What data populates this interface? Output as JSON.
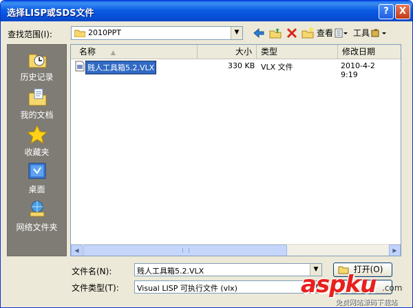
{
  "window": {
    "title": "选择LISP或SDS文件",
    "help_label": "?",
    "close_label": "X"
  },
  "lookin": {
    "label": "查找范围(I):",
    "value": "2010PPT"
  },
  "toolbar": {
    "view_label": "查看",
    "tools_label": "工具"
  },
  "places": [
    {
      "label": "历史记录",
      "icon": "history-icon"
    },
    {
      "label": "我的文档",
      "icon": "my-documents-icon"
    },
    {
      "label": "收藏夹",
      "icon": "favorites-icon"
    },
    {
      "label": "桌面",
      "icon": "desktop-icon"
    },
    {
      "label": "网络文件夹",
      "icon": "network-folder-icon"
    }
  ],
  "filelist": {
    "columns": [
      "名称",
      "大小",
      "类型",
      "修改日期"
    ],
    "rows": [
      {
        "name": "贱人工具箱5.2.VLX",
        "size": "330 KB",
        "type": "VLX 文件",
        "modified": "2010-4-2 9:19"
      }
    ]
  },
  "filename": {
    "label": "文件名(N):",
    "value": "贱人工具箱5.2.VLX"
  },
  "filetype": {
    "label": "文件类型(T):",
    "value": "Visual LISP 可执行文件 (vlx)"
  },
  "buttons": {
    "open_label": "打开(O)"
  },
  "watermark": {
    "text": "aspku",
    "suffix": ".com",
    "sub": "免费网站源码下载站"
  },
  "colors": {
    "title_bar": "#0a5fe6",
    "places_bg": "#7f7c75",
    "dialog_bg": "#ece9d8",
    "selection": "#316ac5",
    "watermark_red": "#e8201e"
  }
}
